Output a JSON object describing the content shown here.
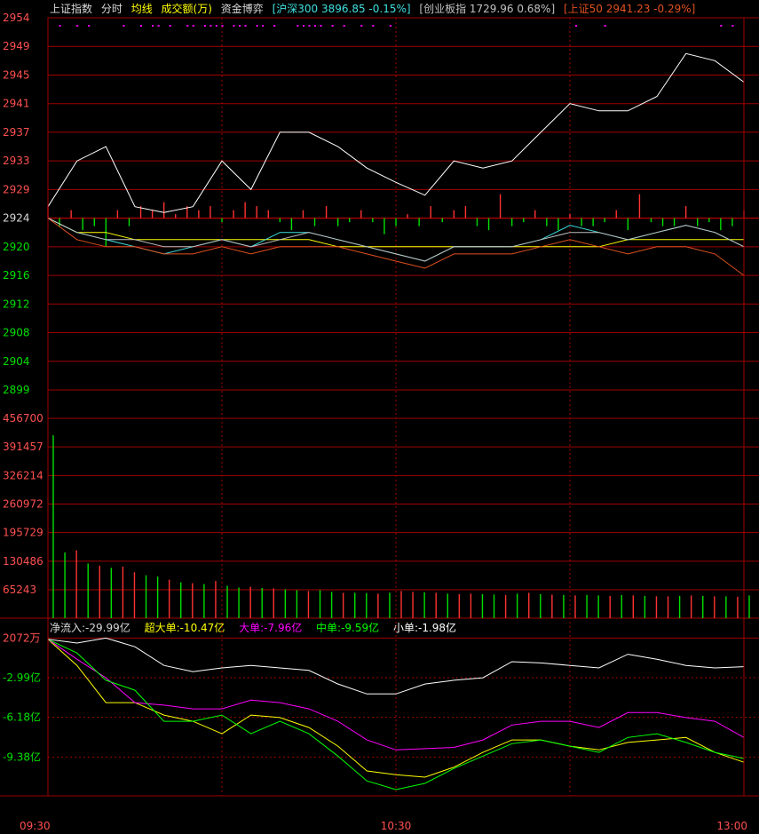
{
  "header": {
    "index_name": "上证指数",
    "tab_intraday": "分时",
    "avg_line": "均线",
    "volume": "成交额(万)",
    "capital": "资金博弈",
    "hs300": "[沪深300 3896.85 -0.15%]",
    "gem": "[创业板指 1729.96 0.68%]",
    "sz50": "[上证50 2941.23 -0.29%]"
  },
  "colors": {
    "background": "#000000",
    "grid": "#a00000",
    "up": "#ff3232",
    "down": "#00e000",
    "price": "#ffffff",
    "avg": "#ffff00",
    "hs300": "#40e0e0",
    "sz50": "#e05020",
    "gem": "#c0c0c0",
    "super_large": "#ffff00",
    "large": "#ff00ff",
    "medium": "#00ff00",
    "small": "#ffffff",
    "markers": "#ff00ff"
  },
  "flow_legend": {
    "net": "净流入:-29.99亿",
    "super_large": "超大单:-10.47亿",
    "large": "大单:-7.96亿",
    "medium": "中单:-9.59亿",
    "small": "小单:-1.98亿"
  },
  "chart_data": [
    {
      "type": "line",
      "title": "上证指数 分时",
      "x_ticks": [
        "09:30",
        "10:30",
        "13:00"
      ],
      "x": [
        0,
        5,
        10,
        15,
        20,
        25,
        30,
        35,
        40,
        45,
        50,
        55,
        60,
        65,
        70,
        75,
        80,
        85,
        90,
        95,
        100,
        105,
        110,
        115,
        120
      ],
      "ylim": [
        2899,
        2954
      ],
      "y_ticks": [
        "2954",
        "2949",
        "2945",
        "2941",
        "2937",
        "2933",
        "2929",
        "2924",
        "2920",
        "2916",
        "2912",
        "2908",
        "2904",
        "2899"
      ],
      "prev_close": 2924,
      "series": [
        {
          "name": "price",
          "values": [
            2926,
            2933,
            2935,
            2926,
            2925,
            2926,
            2933,
            2929,
            2937,
            2937,
            2935,
            2932,
            2930,
            2928,
            2933,
            2932,
            2933,
            2937,
            2941,
            2940,
            2940,
            2942,
            2948,
            2947,
            2944
          ]
        },
        {
          "name": "avg",
          "values": [
            2924,
            2922,
            2922,
            2921,
            2921,
            2921,
            2921,
            2921,
            2921,
            2921,
            2920,
            2920,
            2920,
            2920,
            2920,
            2920,
            2920,
            2920,
            2920,
            2920,
            2921,
            2921,
            2921,
            2921,
            2921
          ]
        },
        {
          "name": "沪深300",
          "values": [
            2924,
            2922,
            2921,
            2920,
            2919,
            2920,
            2921,
            2920,
            2922,
            2922,
            2921,
            2920,
            2919,
            2918,
            2920,
            2920,
            2920,
            2921,
            2923,
            2922,
            2921,
            2922,
            2923,
            2922,
            2920
          ]
        },
        {
          "name": "上证50",
          "values": [
            2924,
            2921,
            2920,
            2920,
            2919,
            2919,
            2920,
            2919,
            2920,
            2920,
            2920,
            2919,
            2918,
            2917,
            2919,
            2919,
            2919,
            2920,
            2921,
            2920,
            2919,
            2920,
            2920,
            2919,
            2916
          ]
        },
        {
          "name": "创业板指",
          "values": [
            2924,
            2922,
            2921,
            2921,
            2920,
            2920,
            2921,
            2920,
            2921,
            2922,
            2921,
            2920,
            2919,
            2918,
            2920,
            2920,
            2920,
            2921,
            2922,
            2922,
            2921,
            2922,
            2923,
            2922,
            2920
          ]
        }
      ],
      "bar_times": [
        0,
        2,
        4,
        6,
        8,
        10,
        12,
        14,
        16,
        18,
        20,
        22,
        24,
        26,
        28,
        30,
        32,
        34,
        36,
        38,
        40,
        42,
        44,
        46,
        48,
        50,
        52,
        54,
        56,
        58,
        60,
        62,
        64,
        66,
        68,
        70,
        72,
        74,
        76,
        78,
        80,
        82,
        84,
        86,
        88,
        90,
        92,
        94,
        96,
        98,
        100,
        102,
        104,
        106,
        108,
        110,
        112,
        114,
        116,
        118,
        120
      ],
      "bar_values": [
        3,
        -2,
        2,
        -3,
        -2,
        -7,
        2,
        -2,
        3,
        2,
        4,
        1,
        3,
        2,
        3,
        -1,
        2,
        4,
        3,
        2,
        -1,
        -3,
        2,
        -2,
        3,
        -2,
        -1,
        2,
        -1,
        -4,
        -2,
        1,
        -2,
        3,
        -1,
        2,
        3,
        -2,
        -3,
        6,
        -2,
        -1,
        2,
        -2,
        -3,
        1,
        -2,
        -2,
        -1,
        2,
        -3,
        6,
        -1,
        -2,
        -2,
        3,
        -2,
        -1,
        -3,
        -2,
        2
      ]
    },
    {
      "type": "bar",
      "title": "成交额(万)",
      "y_ticks": [
        "456700",
        "391457",
        "326214",
        "260972",
        "195729",
        "130486",
        "65243"
      ],
      "ylim": [
        0,
        456700
      ],
      "x": [
        0,
        2,
        4,
        6,
        8,
        10,
        12,
        14,
        16,
        18,
        20,
        22,
        24,
        26,
        28,
        30,
        32,
        34,
        36,
        38,
        40,
        42,
        44,
        46,
        48,
        50,
        52,
        54,
        56,
        58,
        60,
        62,
        64,
        66,
        68,
        70,
        72,
        74,
        76,
        78,
        80,
        82,
        84,
        86,
        88,
        90,
        92,
        94,
        96,
        98,
        100,
        102,
        104,
        106,
        108,
        110,
        112,
        114,
        116,
        118,
        120
      ],
      "values": [
        418000,
        150000,
        155000,
        125000,
        120000,
        115000,
        118000,
        105000,
        98000,
        95000,
        88000,
        82000,
        80000,
        78000,
        85000,
        74000,
        70000,
        72000,
        69000,
        68000,
        66000,
        64000,
        62000,
        64000,
        60000,
        58000,
        58000,
        57000,
        56000,
        58000,
        62000,
        60000,
        59000,
        58000,
        56000,
        55000,
        56000,
        55000,
        54000,
        53000,
        56000,
        58000,
        55000,
        54000,
        53000,
        52000,
        53000,
        52000,
        51000,
        53000,
        52000,
        51000,
        50000,
        50000,
        51000,
        52000,
        51000,
        50000,
        50000,
        49000,
        52000
      ],
      "directions": [
        "down",
        "down",
        "up",
        "down",
        "up",
        "down",
        "up",
        "up",
        "down",
        "down",
        "up",
        "down",
        "up",
        "down",
        "up",
        "down",
        "down",
        "up",
        "down",
        "up",
        "down",
        "down",
        "up",
        "down",
        "down",
        "up",
        "down",
        "down",
        "up",
        "down",
        "up",
        "up",
        "down",
        "up",
        "down",
        "up",
        "up",
        "down",
        "down",
        "up",
        "down",
        "up",
        "down",
        "up",
        "down",
        "up",
        "down",
        "down",
        "up",
        "down",
        "up",
        "down",
        "up",
        "up",
        "down",
        "up",
        "down",
        "up",
        "down",
        "up",
        "down"
      ]
    },
    {
      "type": "line",
      "title": "资金博弈",
      "y_ticks": [
        "2072万",
        "-2.99亿",
        "-6.18亿",
        "-9.38亿"
      ],
      "ylim": [
        -12.5,
        0.3
      ],
      "x": [
        0,
        5,
        10,
        15,
        20,
        25,
        30,
        35,
        40,
        45,
        50,
        55,
        60,
        65,
        70,
        75,
        80,
        85,
        90,
        95,
        100,
        105,
        110,
        115,
        120
      ],
      "series": [
        {
          "name": "超大单",
          "values": [
            0.1,
            -2,
            -5,
            -5,
            -6,
            -6.5,
            -7.5,
            -6,
            -6.2,
            -7,
            -8.5,
            -10.5,
            -10.8,
            -11,
            -10.2,
            -9,
            -8,
            -8,
            -8.5,
            -8.8,
            -8.2,
            -8,
            -7.8,
            -9,
            -9.8
          ]
        },
        {
          "name": "大单",
          "values": [
            0.1,
            -1.5,
            -3,
            -5,
            -5.2,
            -5.5,
            -5.5,
            -4.8,
            -5,
            -5.5,
            -6.5,
            -8,
            -8.8,
            -8.7,
            -8.6,
            -8,
            -6.8,
            -6.5,
            -6.5,
            -7,
            -5.8,
            -5.8,
            -6.2,
            -6.5,
            -7.8
          ]
        },
        {
          "name": "中单",
          "values": [
            0.1,
            -1,
            -3.2,
            -4,
            -6.5,
            -6.5,
            -6,
            -7.5,
            -6.5,
            -7.5,
            -9.3,
            -11.3,
            -12,
            -11.5,
            -10.3,
            -9.3,
            -8.3,
            -8,
            -8.5,
            -9,
            -7.8,
            -7.5,
            -8.2,
            -9,
            -9.5
          ]
        },
        {
          "name": "小单",
          "values": [
            0.1,
            -0.2,
            0.2,
            -0.5,
            -2,
            -2.5,
            -2.2,
            -2,
            -2.2,
            -2.4,
            -3.5,
            -4.3,
            -4.3,
            -3.5,
            -3.2,
            -3,
            -1.7,
            -1.8,
            -2,
            -2.2,
            -1.1,
            -1.5,
            -2,
            -2.2,
            -2.1
          ]
        }
      ]
    }
  ]
}
